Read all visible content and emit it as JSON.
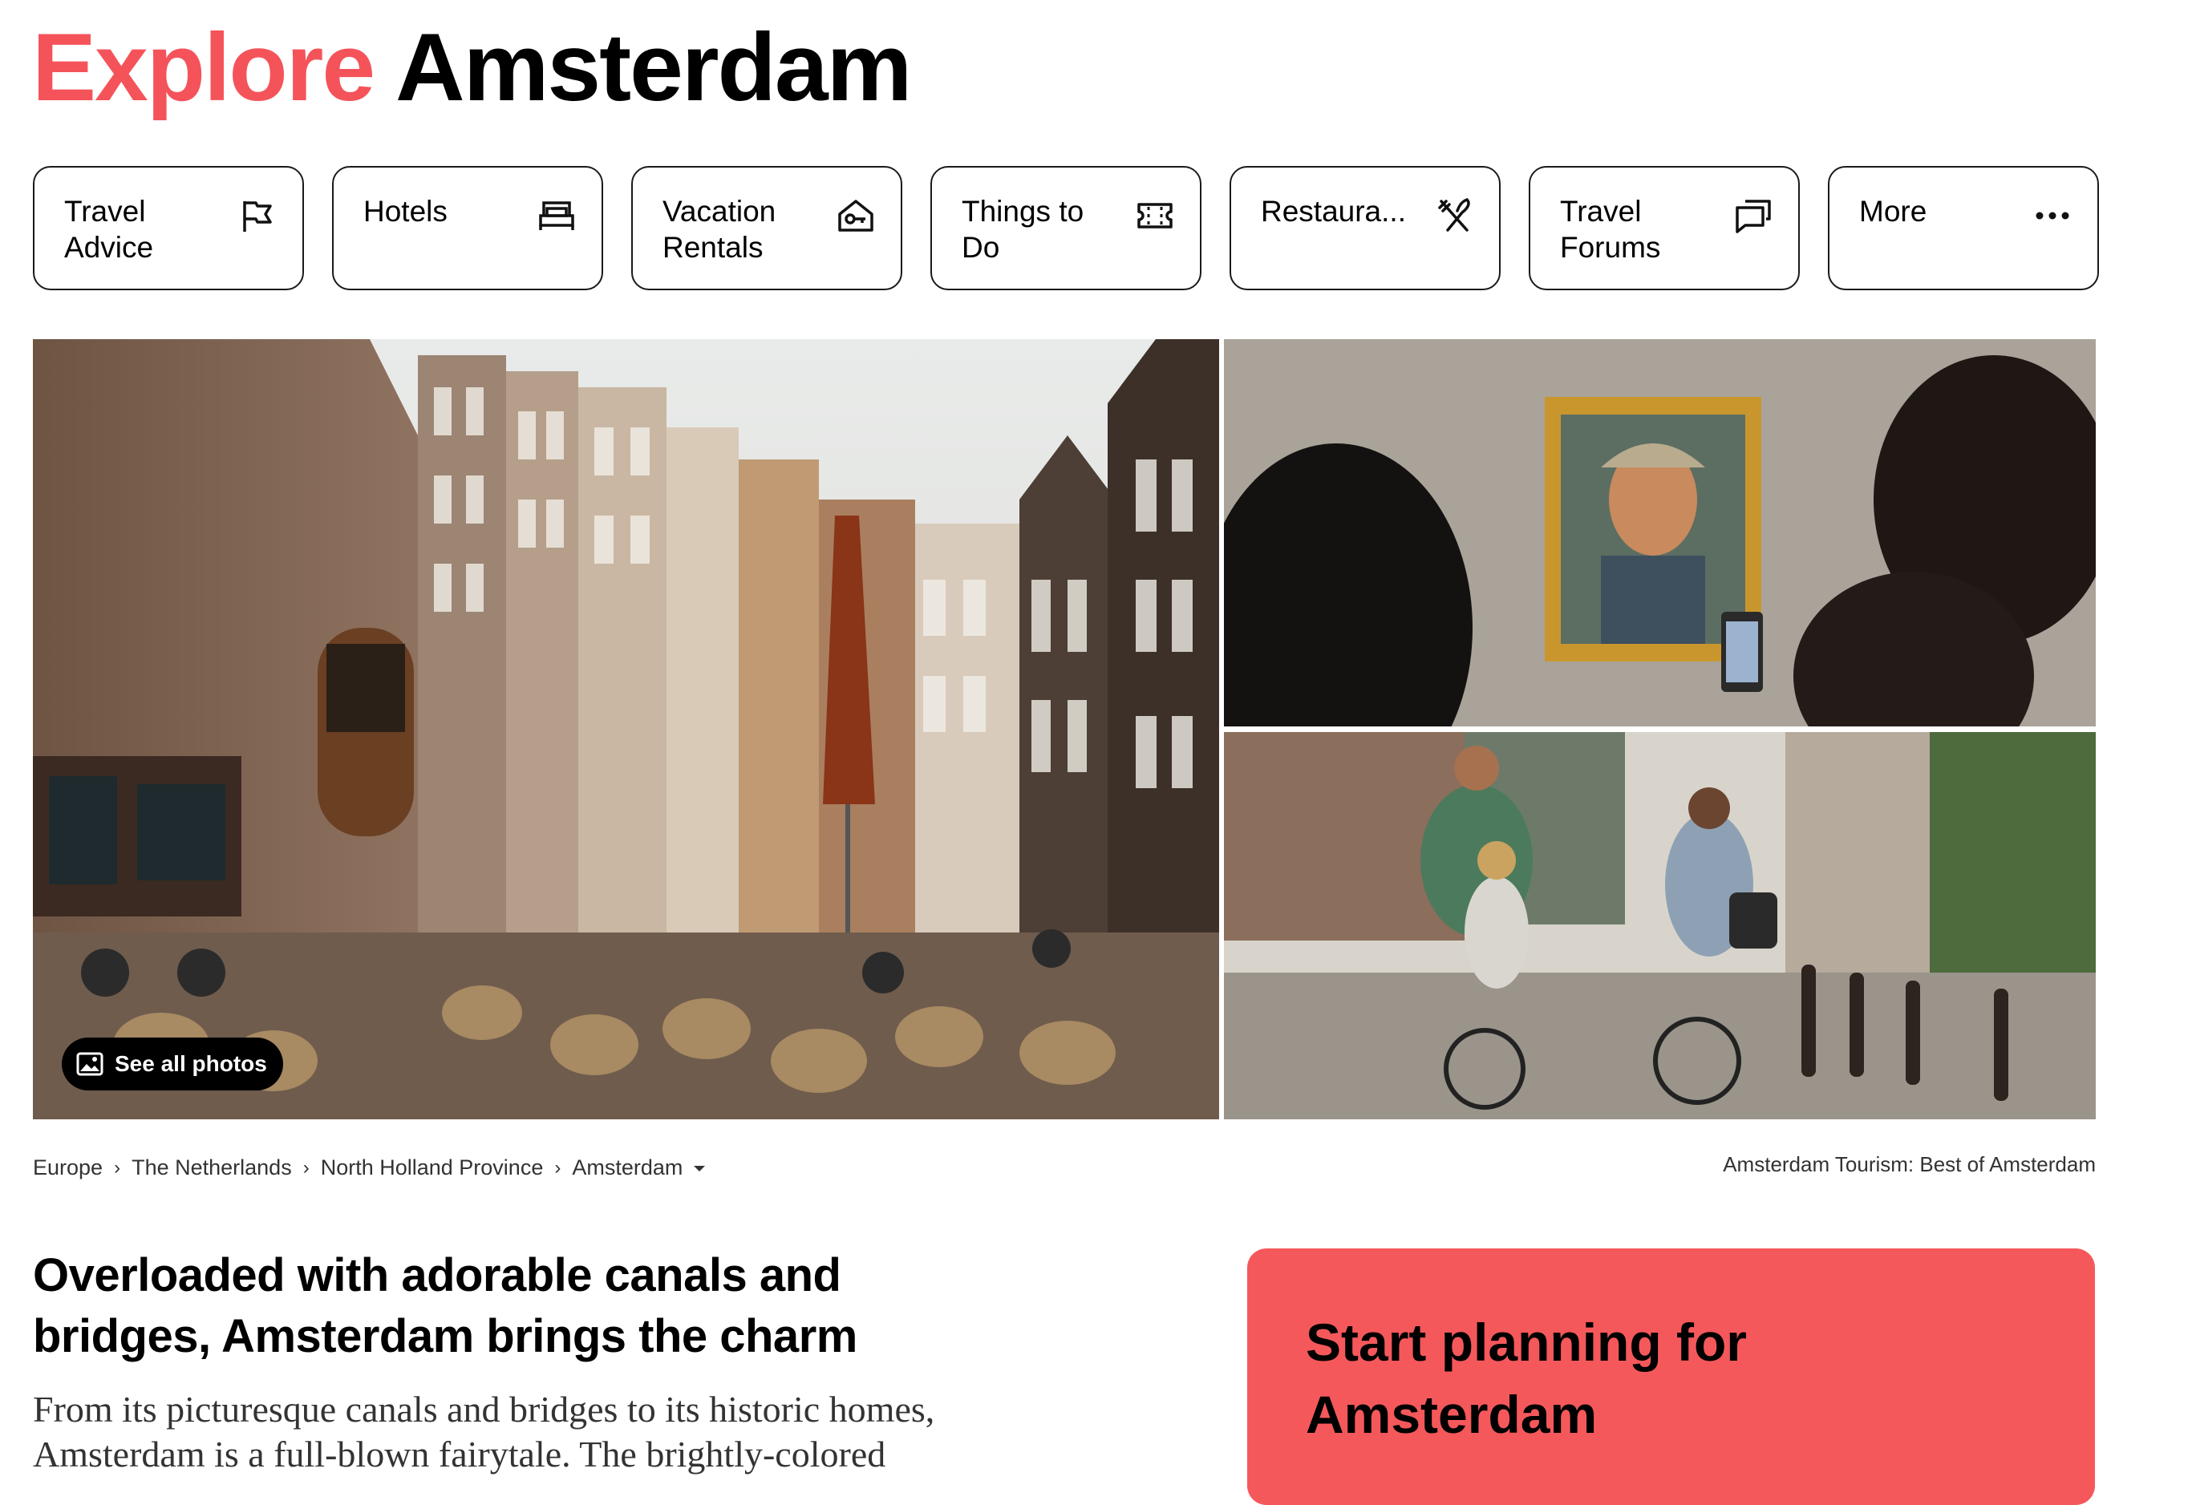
{
  "header": {
    "title_accent": "Explore",
    "title_city": "Amsterdam"
  },
  "tabs": [
    {
      "label": "Travel Advice",
      "icon": "flag-icon"
    },
    {
      "label": "Hotels",
      "icon": "bed-icon"
    },
    {
      "label": "Vacation Rentals",
      "icon": "house-key-icon"
    },
    {
      "label": "Things to Do",
      "icon": "ticket-icon"
    },
    {
      "label": "Restaura...",
      "icon": "fork-knife-icon"
    },
    {
      "label": "Travel Forums",
      "icon": "chat-bubbles-icon"
    },
    {
      "label": "More",
      "icon": "more-dots-icon"
    }
  ],
  "gallery": {
    "see_all_label": "See all photos"
  },
  "breadcrumb": {
    "items": [
      "Europe",
      "The Netherlands",
      "North Holland Province",
      "Amsterdam"
    ]
  },
  "tourism_label": "Amsterdam Tourism: Best of Amsterdam",
  "intro": {
    "headline": "Overloaded with adorable canals and bridges, Amsterdam brings the charm",
    "body": "From its picturesque canals and bridges to its historic homes, Amsterdam is a full-blown fairytale. The brightly-colored"
  },
  "plan_card": {
    "title": "Start planning for Amsterdam"
  },
  "colors": {
    "accent": "#f5535a",
    "card": "#f5585b",
    "text": "#000000"
  }
}
